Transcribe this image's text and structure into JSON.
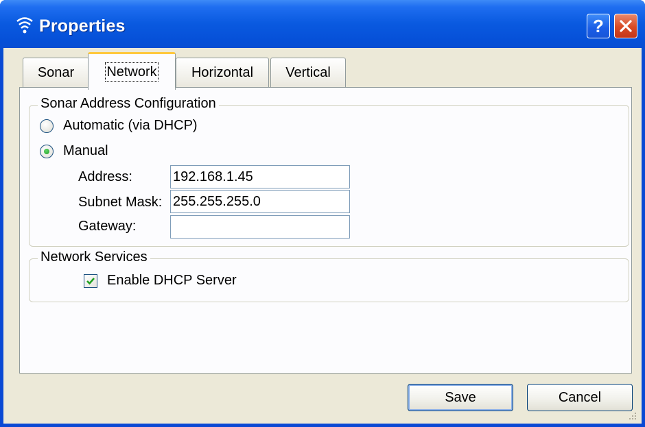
{
  "window": {
    "title": "Properties",
    "help_label": "?",
    "close_label": "✕",
    "icon": "sonar-waves-icon"
  },
  "tabs": [
    {
      "label": "Sonar",
      "active": false
    },
    {
      "label": "Network",
      "active": true
    },
    {
      "label": "Horizontal",
      "active": false
    },
    {
      "label": "Vertical",
      "active": false
    }
  ],
  "address_group": {
    "legend": "Sonar Address Configuration",
    "auto_label": "Automatic (via DHCP)",
    "auto_selected": false,
    "manual_label": "Manual",
    "manual_selected": true,
    "address_label": "Address:",
    "address_value": "192.168.1.45",
    "subnet_label": "Subnet Mask:",
    "subnet_value": "255.255.255.0",
    "gateway_label": "Gateway:",
    "gateway_value": ""
  },
  "services_group": {
    "legend": "Network Services",
    "dhcp_label": "Enable DHCP Server",
    "dhcp_checked": true
  },
  "buttons": {
    "save": "Save",
    "cancel": "Cancel"
  },
  "colors": {
    "titlebar": "#0650d8",
    "close": "#d84a24",
    "active_tab_highlight": "#ffc83c",
    "check": "#21a121"
  }
}
